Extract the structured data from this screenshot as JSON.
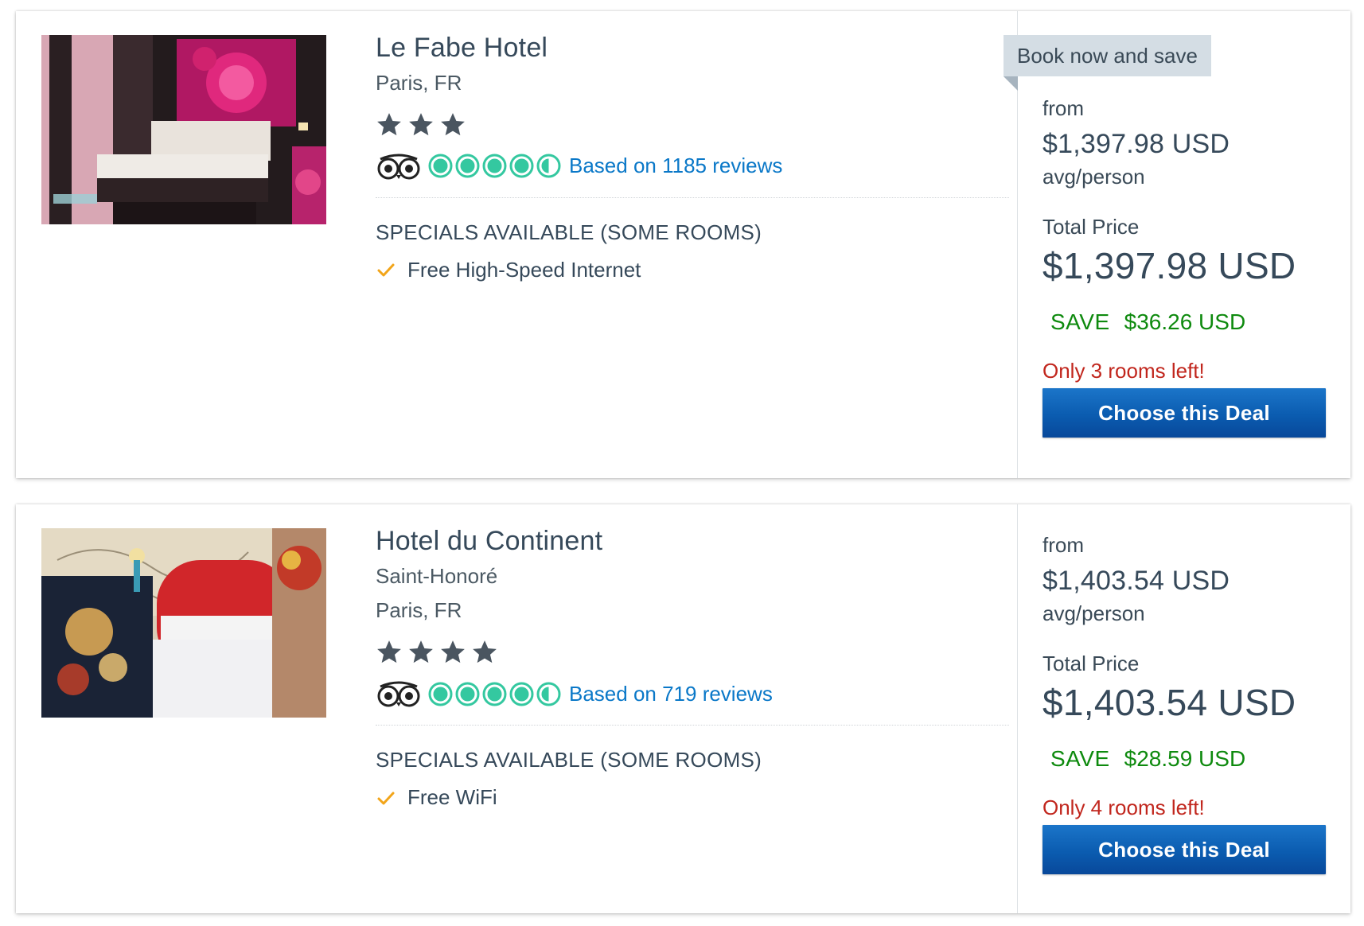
{
  "hotels": [
    {
      "name": "Le Fabe Hotel",
      "location_lines": [
        "Paris, FR"
      ],
      "star_count": 3,
      "tripadvisor_rating": 4.5,
      "reviews_text": "Based on 1185 reviews",
      "specials_heading": "SPECIALS AVAILABLE (SOME ROOMS)",
      "amenity": "Free High-Speed Internet",
      "banner": "Book now and save",
      "from_label": "from",
      "per_person_price": "$1,397.98 USD",
      "per_person_label": "avg/person",
      "total_label": "Total Price",
      "total_price": "$1,397.98 USD",
      "save_label": "SAVE",
      "save_amount": "$36.26 USD",
      "rooms_left": "Only 3 rooms left!",
      "button_label": "Choose this Deal"
    },
    {
      "name": "Hotel du Continent",
      "location_lines": [
        "Saint-Honoré",
        "Paris, FR"
      ],
      "star_count": 4,
      "tripadvisor_rating": 4.5,
      "reviews_text": "Based on 719 reviews",
      "specials_heading": "SPECIALS AVAILABLE (SOME ROOMS)",
      "amenity": "Free WiFi",
      "from_label": "from",
      "per_person_price": "$1,403.54 USD",
      "per_person_label": "avg/person",
      "total_label": "Total Price",
      "total_price": "$1,403.54 USD",
      "save_label": "SAVE",
      "save_amount": "$28.59 USD",
      "rooms_left": "Only 4 rooms left!",
      "button_label": "Choose this Deal"
    }
  ],
  "icons": {
    "star": "star-icon",
    "tripadvisor": "tripadvisor-owl-icon",
    "bubble": "rating-bubble-icon",
    "check": "check-icon"
  },
  "colors": {
    "link": "#0a78c8",
    "save_green": "#0e8a0e",
    "alert_red": "#c1261d",
    "button_blue": "#0b5cb0",
    "bubble_green": "#34c8a0",
    "check_orange": "#f2a51a",
    "star_gray": "#4a5560"
  }
}
